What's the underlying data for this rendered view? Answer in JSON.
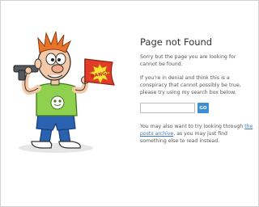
{
  "page": {
    "title": "Page not Found",
    "intro": "Sorry but the page you are looking for cannot be found.",
    "denial_text": "If you're in denial and think this is a conspiracy that cannot possibly be true, please try using my search box below.",
    "archive_before": "You may also want to try looking through ",
    "archive_link": "the posts archive",
    "archive_after": ", as you may just find something else to read instead."
  },
  "search": {
    "value": "",
    "placeholder": "",
    "button_label": "GO"
  },
  "illustration": {
    "flag_text": "BANG!",
    "colors": {
      "shirt": "#8fd14f",
      "pants": "#2b62b0",
      "hair": "#e8732a",
      "flag": "#e23b2a",
      "burst": "#ffe23a",
      "skin": "#f4c9a8"
    }
  }
}
